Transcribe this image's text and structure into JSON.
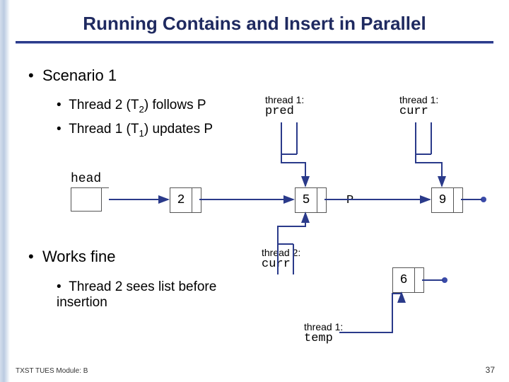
{
  "title": "Running Contains and Insert in Parallel",
  "bullets": {
    "scenario": "Scenario 1",
    "sub1_pre": "Thread 2 (T",
    "sub1_sub": "2",
    "sub1_post": ") follows P",
    "sub2_pre": "Thread 1 (T",
    "sub2_sub": "1",
    "sub2_post": ") updates P",
    "works": "Works fine",
    "sees": "Thread 2 sees list before insertion"
  },
  "labels": {
    "head": "head",
    "t1": "thread 1:",
    "t2": "thread 2:",
    "pred": "pred",
    "curr": "curr",
    "temp": "temp",
    "P": "P"
  },
  "nodes": {
    "n2": "2",
    "n5": "5",
    "n9": "9",
    "n6": "6"
  },
  "footer": "TXST TUES Module: B",
  "page": "37"
}
